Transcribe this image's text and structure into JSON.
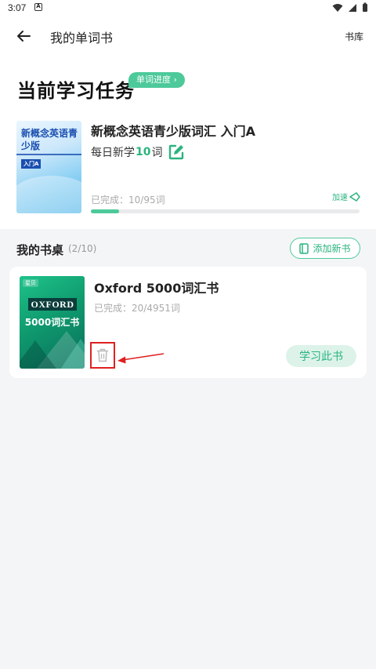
{
  "status_bar": {
    "time": "3:07",
    "notification_letter": "A"
  },
  "header": {
    "title": "我的单词书",
    "library_label": "书库"
  },
  "current_task": {
    "heading": "当前学习任务",
    "progress_badge": "单词进度",
    "book": {
      "cover_title": "新概念英语青少版",
      "cover_tag": "入门A",
      "title": "新概念英语青少版词汇 入门A",
      "daily_prefix": "每日新学",
      "daily_count": "10",
      "daily_suffix": "词",
      "completed": "已完成：10/95词",
      "progress": 0.105,
      "speed_label": "加速"
    }
  },
  "desk": {
    "title": "我的书桌",
    "count": "(2/10)",
    "add_button": "添加新书",
    "books": [
      {
        "cover_brand": "星贝",
        "cover_name": "OXFORD",
        "cover_sub": "5000词汇书",
        "title": "Oxford 5000词汇书",
        "completed": "已完成：20/4951词",
        "study_button": "学习此书"
      }
    ]
  },
  "colors": {
    "accent": "#4dc99a",
    "accent_text": "#2ab47e",
    "annotation": "#e02020"
  }
}
